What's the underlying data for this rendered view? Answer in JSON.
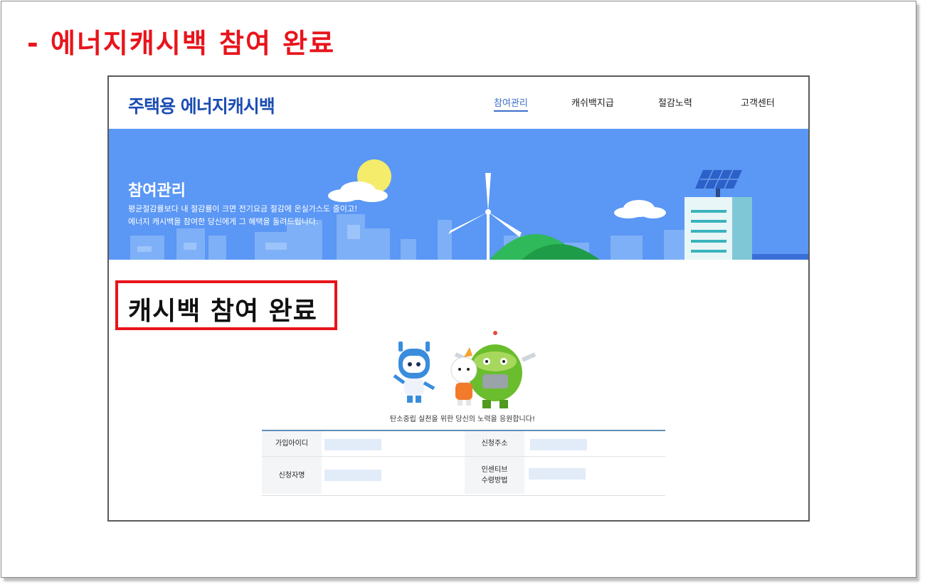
{
  "slide": {
    "title": "- 에너지캐시백 참여 완료"
  },
  "site": {
    "logo": "주택용 에너지캐시백",
    "nav": [
      {
        "label": "참여관리",
        "active": true
      },
      {
        "label": "캐쉬백지급",
        "active": false
      },
      {
        "label": "절감노력",
        "active": false
      },
      {
        "label": "고객센터",
        "active": false
      }
    ]
  },
  "banner": {
    "title": "참여관리",
    "line1": "평균절감률보다 내 절감률이 크면 전기요금 절감에 온실가스도 줄이고!",
    "line2": "에너지 캐시백을 참여한 당신에게 그 혜택을 돌려드립니다."
  },
  "completion": {
    "label": "캐시백 참여 완료"
  },
  "content": {
    "message": "탄소중립 실천을 위한 당신의 노력을 응원합니다!"
  },
  "info_table": {
    "member_id_label": "가입아이디",
    "applicant_address_label": "신청주소",
    "applicant_name_label": "신청자명",
    "incentive_method_label_line1": "인센티브",
    "incentive_method_label_line2": "수령방법"
  },
  "colors": {
    "slide_title": "#e8141b",
    "highlight_border": "#e8141b",
    "logo": "#1c4db3",
    "banner": "#5b97f4",
    "nav_active": "#3d6fc9",
    "table_top_border": "#5d8fb8"
  }
}
